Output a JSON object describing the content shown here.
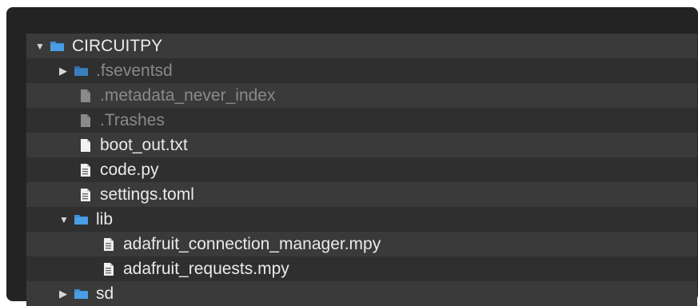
{
  "tree": {
    "items": [
      {
        "label": "CIRCUITPY",
        "type": "folder",
        "expanded": true,
        "depth": 0,
        "dimmed": false,
        "icon": "folder-icon"
      },
      {
        "label": ".fseventsd",
        "type": "folder",
        "expanded": false,
        "depth": 1,
        "dimmed": true,
        "icon": "folder-icon"
      },
      {
        "label": ".metadata_never_index",
        "type": "file",
        "depth": 1,
        "dimmed": true,
        "icon": "document-icon"
      },
      {
        "label": ".Trashes",
        "type": "file",
        "depth": 1,
        "dimmed": true,
        "icon": "document-icon"
      },
      {
        "label": "boot_out.txt",
        "type": "file",
        "depth": 1,
        "dimmed": false,
        "icon": "document-icon"
      },
      {
        "label": "code.py",
        "type": "file",
        "depth": 1,
        "dimmed": false,
        "icon": "binary-file-icon"
      },
      {
        "label": "settings.toml",
        "type": "file",
        "depth": 1,
        "dimmed": false,
        "icon": "binary-file-icon"
      },
      {
        "label": "lib",
        "type": "folder",
        "expanded": true,
        "depth": 1,
        "dimmed": false,
        "icon": "folder-icon"
      },
      {
        "label": "adafruit_connection_manager.mpy",
        "type": "file",
        "depth": 2,
        "dimmed": false,
        "icon": "binary-file-icon"
      },
      {
        "label": "adafruit_requests.mpy",
        "type": "file",
        "depth": 2,
        "dimmed": false,
        "icon": "binary-file-icon"
      },
      {
        "label": "sd",
        "type": "folder",
        "expanded": false,
        "depth": 1,
        "dimmed": false,
        "icon": "folder-icon"
      }
    ]
  },
  "colors": {
    "panel_background": "#232323",
    "row_odd": "#3a3a3a",
    "row_even": "#2f2f2f",
    "folder_blue": "#3b8fd9",
    "text_primary": "#eaeaea",
    "text_dimmed": "#8a8a8a"
  }
}
